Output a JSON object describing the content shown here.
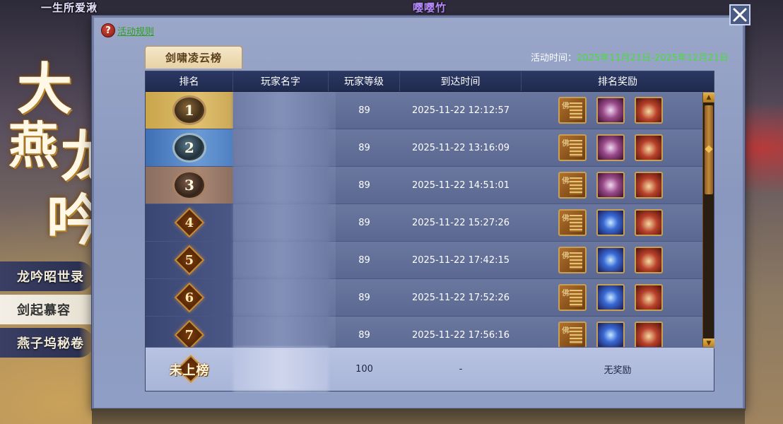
{
  "scene": {
    "top_left_name": "一生所爱湫",
    "top_mid_name": "嘤嘤竹"
  },
  "title_art": [
    "大",
    "燕",
    "龙",
    "吟"
  ],
  "side_menu": [
    {
      "label": "龙吟昭世录",
      "active": false
    },
    {
      "label": "剑起慕容",
      "active": true
    },
    {
      "label": "燕子坞秘卷",
      "active": false
    }
  ],
  "panel": {
    "rules_label": "活动规则",
    "tab_label": "剑啸凌云榜",
    "time_label": "活动时间：",
    "time_value": "2025年11月21日-2025年12月21日"
  },
  "table": {
    "headers": [
      "排名",
      "玩家名字",
      "玩家等级",
      "到达时间",
      "排名奖励"
    ],
    "rows": [
      {
        "rank": "1",
        "level": "89",
        "time": "2025-11-22  12:12:57"
      },
      {
        "rank": "2",
        "level": "89",
        "time": "2025-11-22  13:16:09"
      },
      {
        "rank": "3",
        "level": "89",
        "time": "2025-11-22  14:51:01"
      },
      {
        "rank": "4",
        "level": "89",
        "time": "2025-11-22  15:27:26"
      },
      {
        "rank": "5",
        "level": "89",
        "time": "2025-11-22  17:42:15"
      },
      {
        "rank": "6",
        "level": "89",
        "time": "2025-11-22  17:52:26"
      },
      {
        "rank": "7",
        "level": "89",
        "time": "2025-11-22  17:56:16"
      }
    ],
    "my_row": {
      "rank_label": "未上榜",
      "level": "100",
      "time": "-",
      "reward": "无奖励"
    }
  },
  "colors": {
    "accent_green": "#4bdc3a",
    "link_green": "#2e9f1e",
    "header_navy": "#1f2a4e",
    "gold_border": "#c8a055"
  },
  "icons": {
    "close": "close-x-icon",
    "rules": "question-icon",
    "rewards": [
      "scripture-book-icon",
      "purple-scroll-icon",
      "treasure-chest-icon",
      "blue-wing-icon"
    ]
  }
}
